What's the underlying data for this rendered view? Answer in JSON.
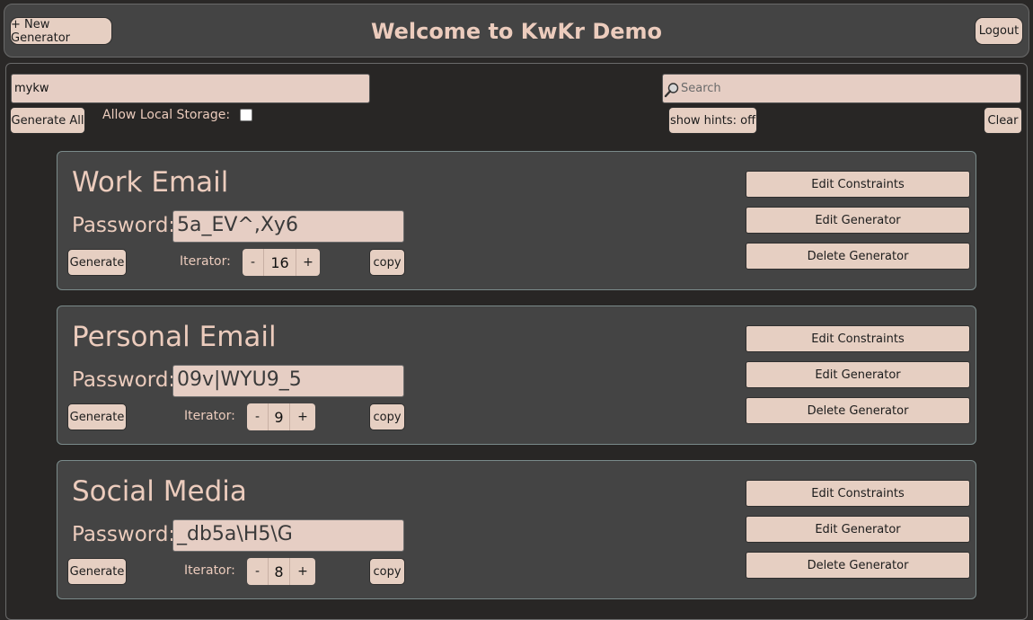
{
  "header": {
    "title": "Welcome to KwKr Demo",
    "new_generator_label": "+ New Generator",
    "logout_label": "Logout"
  },
  "controls": {
    "keyword_value": "mykw",
    "generate_all_label": "Generate All",
    "allow_storage_label": "Allow Local Storage:",
    "allow_storage_checked": false,
    "search_placeholder": "Search",
    "search_icon": "magnifier-icon",
    "hints_label": "show hints: off",
    "clear_label": "Clear"
  },
  "generators": [
    {
      "title": "Work Email",
      "password_label": "Password:",
      "password": "5a_EV^,Xy6",
      "generate_label": "Generate",
      "iterator_label": "Iterator:",
      "decrement_label": "-",
      "iterator": "16",
      "increment_label": "+",
      "copy_label": "copy",
      "edit_constraints_label": "Edit Constraints",
      "edit_generator_label": "Edit Generator",
      "delete_generator_label": "Delete Generator"
    },
    {
      "title": "Personal Email",
      "password_label": "Password:",
      "password": "09v|WYU9_5",
      "generate_label": "Generate",
      "iterator_label": "Iterator:",
      "decrement_label": "-",
      "iterator": "9",
      "increment_label": "+",
      "copy_label": "copy",
      "edit_constraints_label": "Edit Constraints",
      "edit_generator_label": "Edit Generator",
      "delete_generator_label": "Delete Generator"
    },
    {
      "title": "Social Media",
      "password_label": "Password:",
      "password": "_db5a\\H5\\G",
      "generate_label": "Generate",
      "iterator_label": "Iterator:",
      "decrement_label": "-",
      "iterator": "8",
      "increment_label": "+",
      "copy_label": "copy",
      "edit_constraints_label": "Edit Constraints",
      "edit_generator_label": "Edit Generator",
      "delete_generator_label": "Delete Generator"
    }
  ],
  "colors": {
    "page_bg": "#2a2827",
    "panel_bg": "#444444",
    "accent_text": "#ecccbd",
    "button_bg": "#e6cfc2",
    "field_bg": "#e6cec4"
  }
}
